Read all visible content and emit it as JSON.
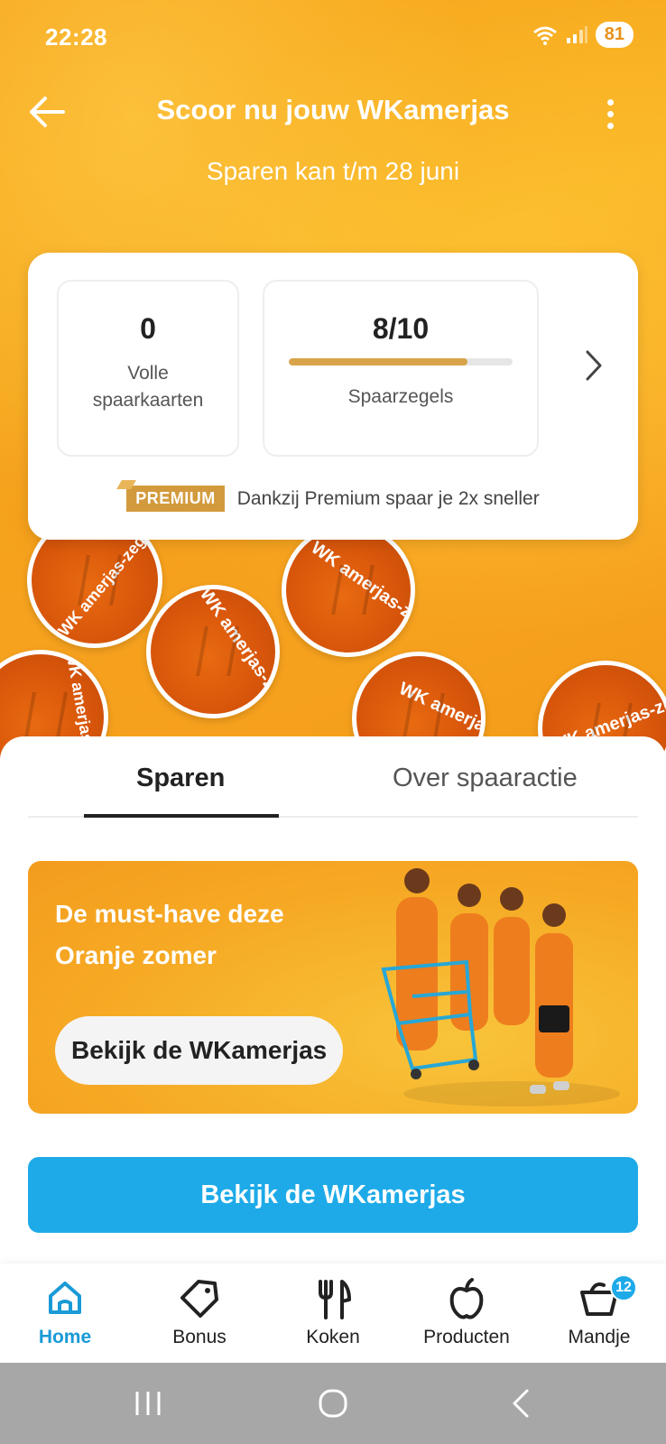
{
  "status_bar": {
    "time": "22:28",
    "battery": "81"
  },
  "header": {
    "title": "Scoor nu jouw WKamerjas",
    "subtitle": "Sparen kan t/m 28 juni"
  },
  "stamps": {
    "label_1": "WK amerjas-zegel",
    "label_2": "WK amerjas-zegel",
    "label_3": "WK amerjas-zegel",
    "label_4": "WK amerjas-zegel",
    "label_5": "WK amerjas-zegel"
  },
  "savings": {
    "full_cards_value": "0",
    "full_cards_label_line1": "Volle",
    "full_cards_label_line2": "spaarkaarten",
    "stamps_value": "8/10",
    "stamps_progress": 0.8,
    "stamps_label": "Spaarzegels",
    "premium_badge": "PREMIUM",
    "premium_text": "Dankzij Premium spaar je 2x sneller"
  },
  "tabs": {
    "sparen": "Sparen",
    "over": "Over spaaractie",
    "active": "Sparen"
  },
  "promo": {
    "title_line1": "De must-have deze",
    "title_line2": "Oranje zomer",
    "button": "Bekijk de WKamerjas"
  },
  "cta": {
    "label": "Bekijk de WKamerjas"
  },
  "nav": {
    "home": "Home",
    "bonus": "Bonus",
    "koken": "Koken",
    "producten": "Producten",
    "mandje": "Mandje",
    "mandje_count": "12",
    "active": "Home"
  },
  "colors": {
    "accent_blue": "#1eaae8",
    "hero_orange": "#f9b523",
    "premium_gold": "#d39a3d"
  }
}
